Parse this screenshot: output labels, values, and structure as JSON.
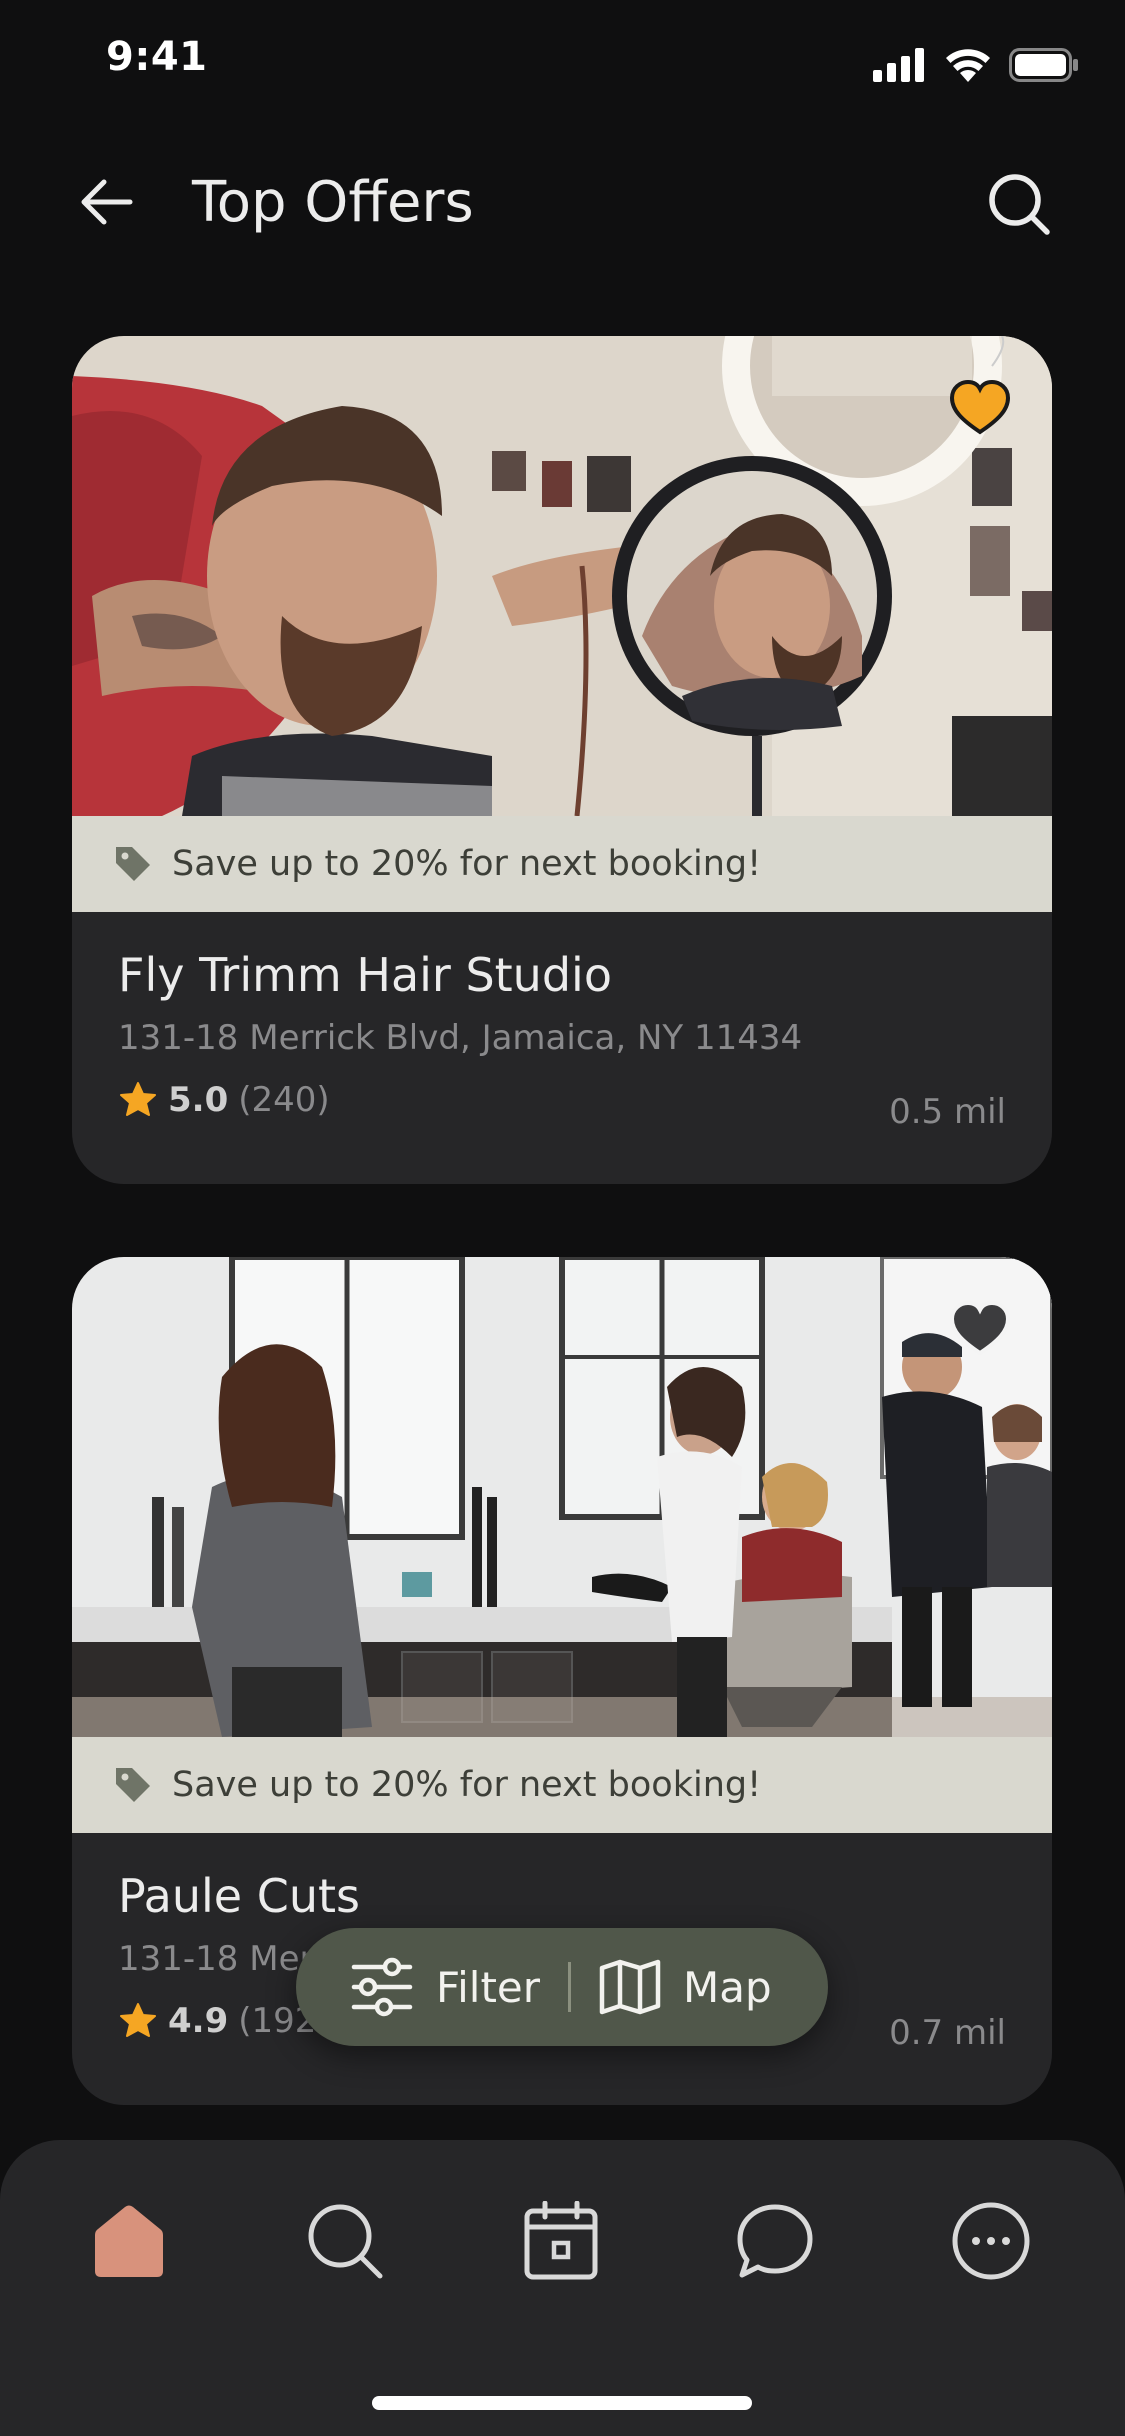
{
  "status_bar": {
    "time": "9:41",
    "signal_icon": "cellular-signal-icon",
    "wifi_icon": "wifi-icon",
    "battery_icon": "battery-icon"
  },
  "header": {
    "title": "Top Offers",
    "back_icon": "arrow-left-icon",
    "search_icon": "search-icon"
  },
  "offers": [
    {
      "image": "barbershop-mirror-photo",
      "favorite": true,
      "promo_icon": "tag-icon",
      "promo": "Save up to 20% for next booking!",
      "name": "Fly Trimm Hair Studio",
      "address": "131-18 Merrick Blvd, Jamaica, NY 11434",
      "rating": "5.0",
      "reviews": "(240)",
      "distance": "0.5 mil"
    },
    {
      "image": "hair-salon-interior-photo",
      "favorite": false,
      "promo_icon": "tag-icon",
      "promo": "Save up to 20% for next booking!",
      "name": "Paule Cuts",
      "address": "131-18 Merrick Blvd, Jamaica, NY 11434",
      "rating": "4.9",
      "reviews": "(192 reviews)",
      "distance": "0.7 mil"
    }
  ],
  "floating_actions": {
    "filter_label": "Filter",
    "filter_icon": "sliders-icon",
    "map_label": "Map",
    "map_icon": "map-icon"
  },
  "tab_bar": {
    "items": [
      {
        "icon": "home-icon",
        "active": true
      },
      {
        "icon": "search-icon",
        "active": false
      },
      {
        "icon": "calendar-icon",
        "active": false
      },
      {
        "icon": "chat-bubble-icon",
        "active": false
      },
      {
        "icon": "more-icon",
        "active": false
      }
    ]
  },
  "colors": {
    "background": "#0f0f10",
    "card": "#262628",
    "promo_strip": "#d9d8cf",
    "favorite_active": "#f5a623",
    "star": "#f5a623",
    "pill": "#50574a",
    "tab_active": "#d8927c"
  }
}
